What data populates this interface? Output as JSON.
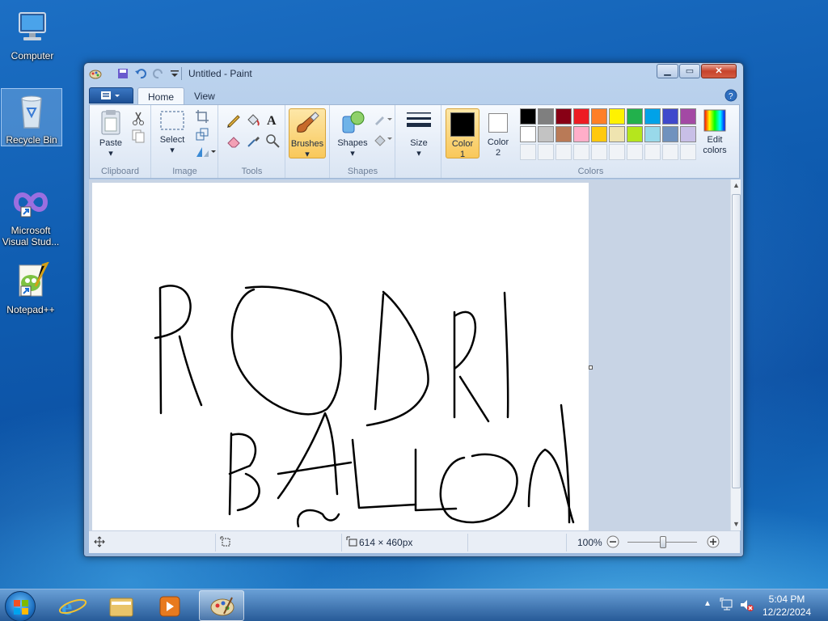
{
  "desktop": {
    "icons": [
      {
        "label": "Computer"
      },
      {
        "label": "Recycle Bin"
      },
      {
        "label_line1": "Microsoft",
        "label_line2": "Visual Stud..."
      },
      {
        "label": "Notepad++"
      }
    ]
  },
  "window": {
    "title": "Untitled - Paint"
  },
  "ribbon": {
    "tabs": [
      "Home",
      "View"
    ],
    "groups": {
      "clipboard": {
        "label": "Clipboard",
        "paste": "Paste"
      },
      "image": {
        "label": "Image",
        "select": "Select"
      },
      "tools": {
        "label": "Tools",
        "text_tool": "A"
      },
      "brushes": {
        "label": "Brushes"
      },
      "shapes": {
        "label": "Shapes",
        "shapes_btn": "Shapes"
      },
      "size": {
        "label": "Size"
      },
      "colors": {
        "label": "Colors",
        "color1": "Color",
        "color1_num": "1",
        "color2": "Color",
        "color2_num": "2",
        "edit_line1": "Edit",
        "edit_line2": "colors",
        "row1": [
          "#000000",
          "#7f7f7f",
          "#880015",
          "#ed1c24",
          "#ff7f27",
          "#fff200",
          "#22b14c",
          "#00a2e8",
          "#3f48cc",
          "#a349a4"
        ],
        "row2": [
          "#ffffff",
          "#c3c3c3",
          "#b97a57",
          "#ffaec9",
          "#ffc90e",
          "#efe4b0",
          "#b5e61d",
          "#99d9ea",
          "#7092be",
          "#c8bfe7"
        ]
      }
    }
  },
  "canvas": {
    "text_line1": "RODRI",
    "text_line2": "BALLON"
  },
  "statusbar": {
    "dimensions": "614 × 460px",
    "zoom": "100%"
  },
  "taskbar": {
    "time": "5:04 PM",
    "date": "12/22/2024"
  }
}
